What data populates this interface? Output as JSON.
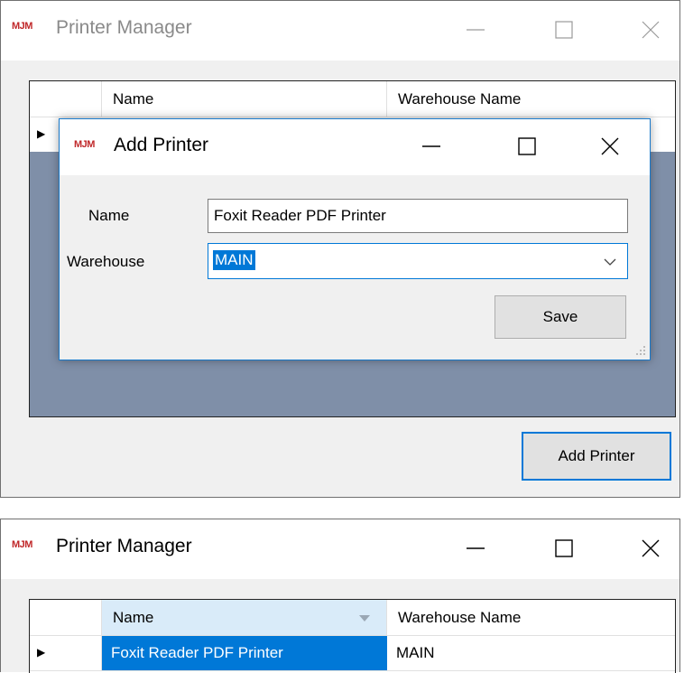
{
  "top": {
    "window": {
      "logo": "MJM",
      "title": "Printer Manager"
    },
    "grid": {
      "columns": [
        "Name",
        "Warehouse Name"
      ],
      "row_indicator": "▶"
    },
    "add_printer_button": "Add Printer",
    "dialog": {
      "logo": "MJM",
      "title": "Add Printer",
      "name_label": "Name",
      "name_value": "Foxit Reader PDF Printer",
      "warehouse_label": "Warehouse",
      "warehouse_value": "MAIN",
      "save_label": "Save"
    }
  },
  "bottom": {
    "window": {
      "logo": "MJM",
      "title": "Printer Manager"
    },
    "grid": {
      "columns": [
        "Name",
        "Warehouse Name"
      ],
      "row_indicator": "▶",
      "rows": [
        {
          "name": "Foxit Reader PDF Printer",
          "warehouse": "MAIN"
        }
      ]
    }
  },
  "colors": {
    "selection": "#0078d7",
    "grid_background": "#7f8fa8",
    "logo": "#c0282a",
    "focus_border": "#0078d7"
  },
  "icons": [
    "minimize-icon",
    "maximize-icon",
    "close-icon",
    "row-indicator-icon",
    "dropdown-chevron-icon",
    "sort-arrow-icon",
    "resize-grip-icon"
  ]
}
